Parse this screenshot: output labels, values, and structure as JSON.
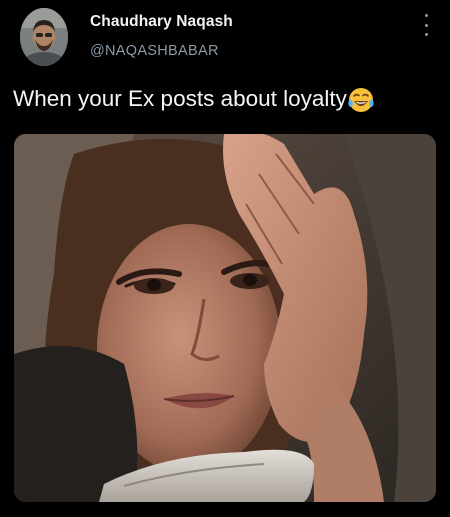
{
  "tweet": {
    "author": {
      "display_name": "Chaudhary Naqash",
      "handle": "@NAQASHBABAR",
      "avatar_icon": "profile-photo"
    },
    "text": "When your Ex posts about loyalty",
    "emoji": "face-with-tears-of-joy",
    "more_icon": "vertical-ellipsis-icon",
    "media_type": "photo"
  },
  "colors": {
    "background": "#000000",
    "name": "#f2f2f2",
    "handle": "#8b98a5",
    "text": "#f5f5f5"
  }
}
